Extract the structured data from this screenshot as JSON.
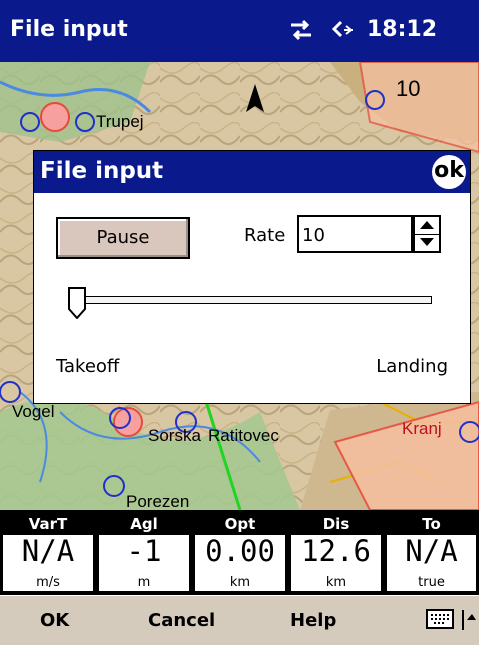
{
  "titlebar": {
    "title": "File input",
    "time": "18:12",
    "icons": [
      "connectivity-icon",
      "speaker-icon"
    ]
  },
  "map": {
    "labels": [
      "Trupej",
      "Vogel",
      "Sorska",
      "Ratitovec",
      "Kranj",
      "Porezen",
      "10"
    ],
    "colors": {
      "terrain": "#d9c6a2",
      "water": "#8cb8e8",
      "airspace_red": "#e84a3a",
      "track_green": "#21d421"
    }
  },
  "dialog": {
    "title": "File input",
    "ok_label": "ok",
    "pause_label": "Pause",
    "rate_label": "Rate",
    "rate_value": "10",
    "slider_position": 0.0,
    "takeoff_label": "Takeoff",
    "landing_label": "Landing"
  },
  "infoboxes": [
    {
      "title": "VarT",
      "value": "N/A",
      "unit": "m/s"
    },
    {
      "title": "Agl",
      "value": "-1",
      "unit": "m"
    },
    {
      "title": "Opt",
      "value": "0.00",
      "unit": "km"
    },
    {
      "title": "Dis",
      "value": "12.6",
      "unit": "km"
    },
    {
      "title": "To",
      "value": "N/A",
      "unit": "true"
    }
  ],
  "softkeys": {
    "ok": "OK",
    "cancel": "Cancel",
    "help": "Help"
  }
}
